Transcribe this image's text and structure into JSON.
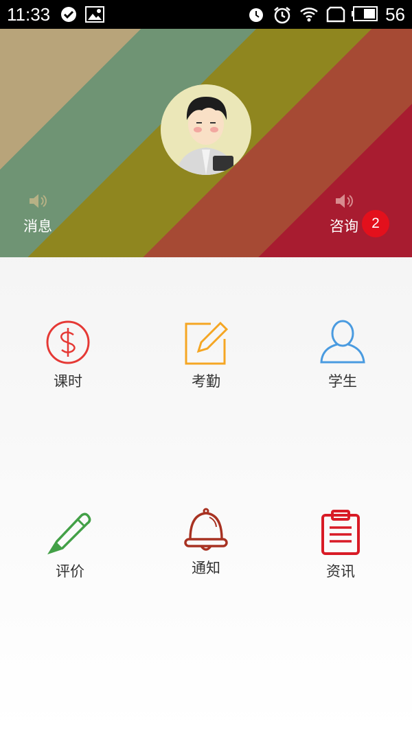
{
  "status_bar": {
    "time": "11:33",
    "battery": "56",
    "icons": [
      "check-circle-icon",
      "image-icon",
      "alarm-snooze-icon",
      "alarm-clock-icon",
      "wifi-icon",
      "screen-rotate-icon",
      "battery-icon"
    ]
  },
  "header": {
    "messages_label": "消息",
    "consult_label": "咨询",
    "consult_badge": "2",
    "avatar": "teacher-avatar"
  },
  "menu": {
    "items": [
      {
        "label": "课时",
        "icon": "dollar-circle-icon",
        "color": "#e53935"
      },
      {
        "label": "考勤",
        "icon": "edit-square-icon",
        "color": "#f5a623"
      },
      {
        "label": "学生",
        "icon": "user-icon",
        "color": "#4a9be0"
      },
      {
        "label": "评价",
        "icon": "pencil-icon",
        "color": "#43a047"
      },
      {
        "label": "通知",
        "icon": "bell-icon",
        "color": "#a83222"
      },
      {
        "label": "资讯",
        "icon": "clipboard-icon",
        "color": "#d81b26"
      }
    ]
  }
}
